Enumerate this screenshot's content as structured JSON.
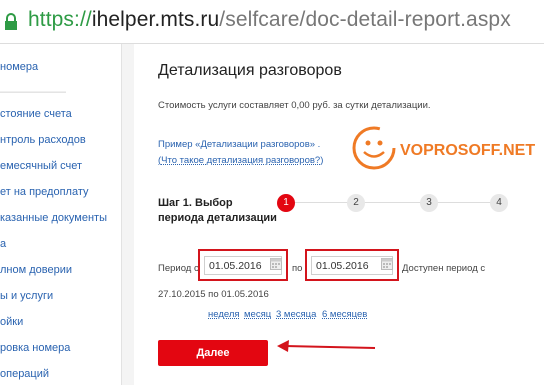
{
  "browser": {
    "url_scheme": "https://",
    "url_host": "ihelper.mts.ru",
    "url_path": "/selfcare/doc-detail-report.aspx"
  },
  "sidebar": {
    "items": [
      "номера",
      "стояние счета",
      "нтроль расходов",
      "емесячный счет",
      "ет на предоплату",
      "казанные документы",
      "а",
      "лном доверии",
      "ы и услуги",
      "ойки",
      "ровка номера",
      "операций"
    ]
  },
  "main": {
    "title": "Детализация разговоров",
    "cost_text": "Стоимость услуги составляет 0,00 руб. за сутки детализации.",
    "example_link": "Пример «Детализации разговоров» .",
    "what_is_link": "Что такое детализация разговоров?",
    "step_label": "Шаг 1. Выбор периода детализации",
    "steps": [
      "1",
      "2",
      "3",
      "4"
    ],
    "period_from_label": "Период с",
    "date_from": "01.05.2016",
    "period_to_label": "по",
    "date_to": "01.05.2016",
    "available_label": "Доступен период с",
    "available_range": "27.10.2015 по 01.05.2016",
    "period_links": [
      "неделя",
      "месяц",
      "3 месяца",
      "6 месяцев"
    ],
    "next_button": "Далее"
  },
  "watermark": {
    "text": "VOPROSOFF.NET"
  },
  "colors": {
    "accent": "#e30611",
    "link": "#2a63b0",
    "secure": "#2e9b45",
    "watermark": "#ef7a25"
  }
}
